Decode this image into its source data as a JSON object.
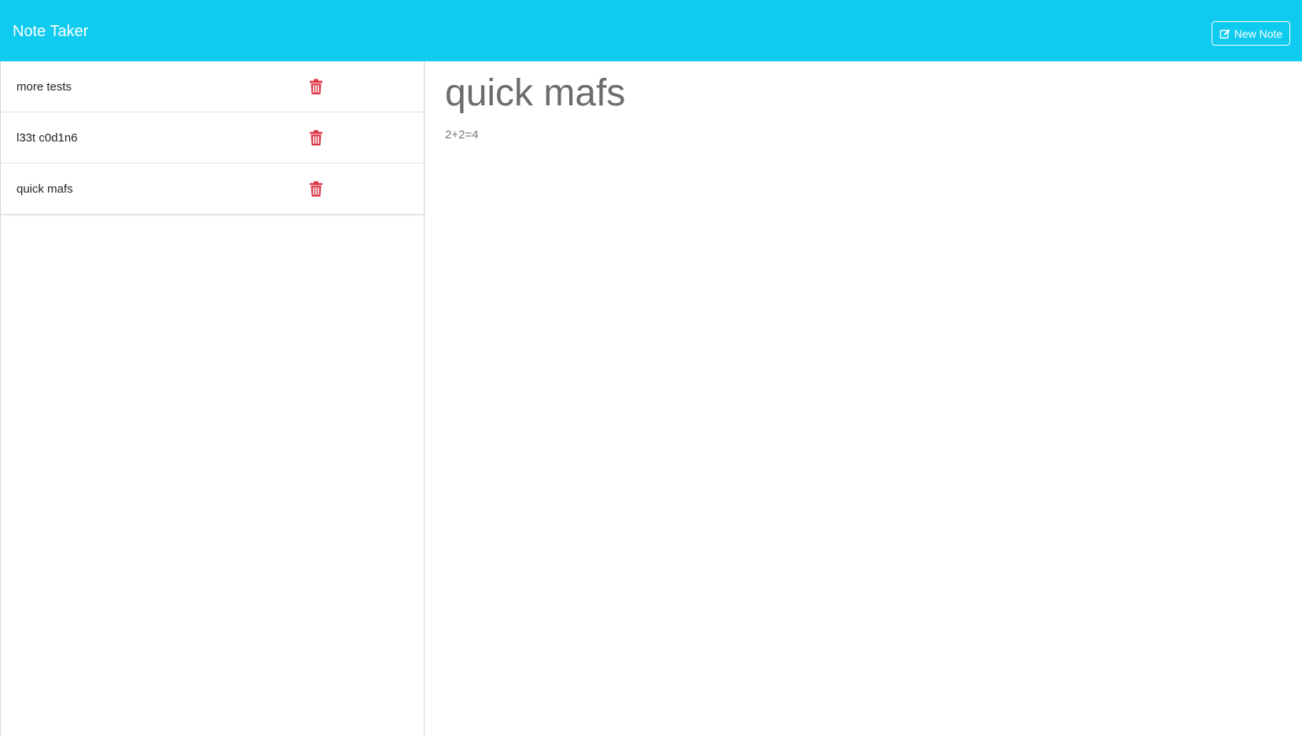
{
  "app": {
    "title": "Note Taker"
  },
  "toolbar": {
    "new_note_label": "New Note",
    "new_note_icon": "edit-icon"
  },
  "notes": [
    {
      "title": "more tests",
      "delete_icon": "trash-icon"
    },
    {
      "title": "l33t c0d1n6",
      "delete_icon": "trash-icon"
    },
    {
      "title": "quick mafs",
      "delete_icon": "trash-icon"
    }
  ],
  "active_note": {
    "title": "quick mafs",
    "text": "2+2=4"
  },
  "colors": {
    "navbar": "#0fcbef",
    "delete": "#dc3545",
    "heading": "#6c6c6c"
  }
}
